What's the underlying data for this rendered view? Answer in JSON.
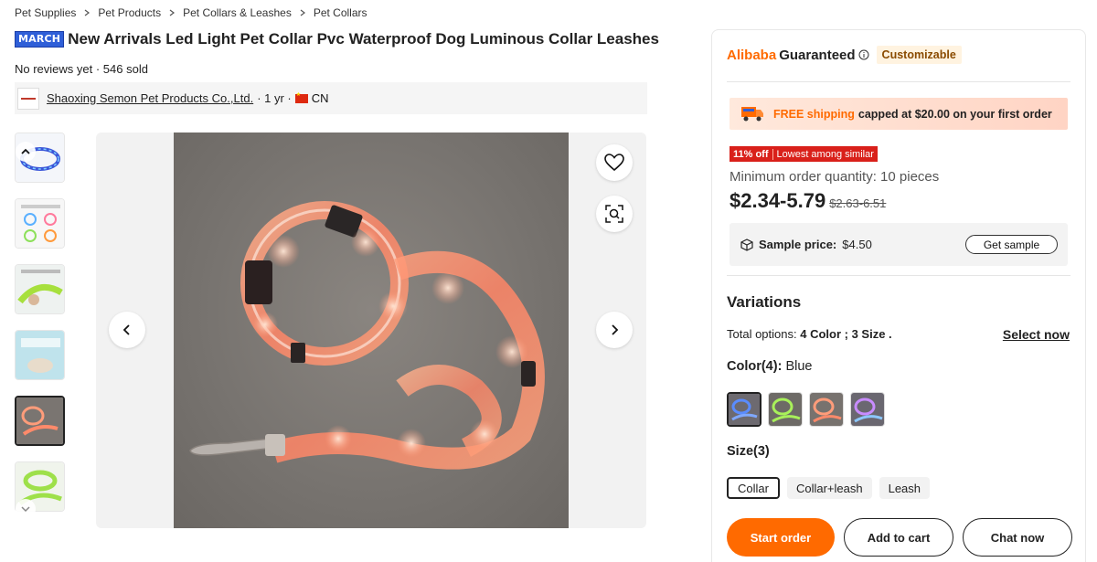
{
  "breadcrumb": [
    "Pet Supplies",
    "Pet Products",
    "Pet Collars & Leashes",
    "Pet Collars"
  ],
  "product": {
    "badge": "MARCH",
    "title": "New Arrivals Led Light Pet Collar Pvc Waterproof Dog Luminous Collar Leashes",
    "reviews": "No reviews yet · 546 sold"
  },
  "supplier": {
    "name": "Shaoxing Semon Pet Products Co.,Ltd.",
    "years": "· 1 yr ·",
    "country": "CN"
  },
  "panel": {
    "brand_a": "Alibaba",
    "brand_b": "Guaranteed",
    "customizable": "Customizable",
    "shipping_free": "FREE shipping",
    "shipping_rest": "capped at $20.00 on your first order",
    "discount_pct": "11% off",
    "discount_label": "Lowest among similar",
    "min_order": "Minimum order quantity: 10 pieces",
    "price": "$2.34-5.79",
    "old_price": "$2.63-6.51",
    "sample_label": "Sample price:",
    "sample_value": "$4.50",
    "sample_button": "Get sample",
    "variations_title": "Variations",
    "total_options_prefix": "Total options:",
    "total_options_value": "4 Color ; 3 Size .",
    "select_now": "Select now",
    "color_label": "Color(4):",
    "color_selected": "Blue",
    "size_label": "Size(3)",
    "sizes": [
      "Collar",
      "Collar+leash",
      "Leash"
    ],
    "actions": {
      "start_order": "Start order",
      "add_to_cart": "Add to cart",
      "chat_now": "Chat now"
    }
  },
  "colors": {
    "accent": "#ff6a00",
    "discount_red": "#d9201a",
    "badge_blue": "#2f5fd8"
  }
}
